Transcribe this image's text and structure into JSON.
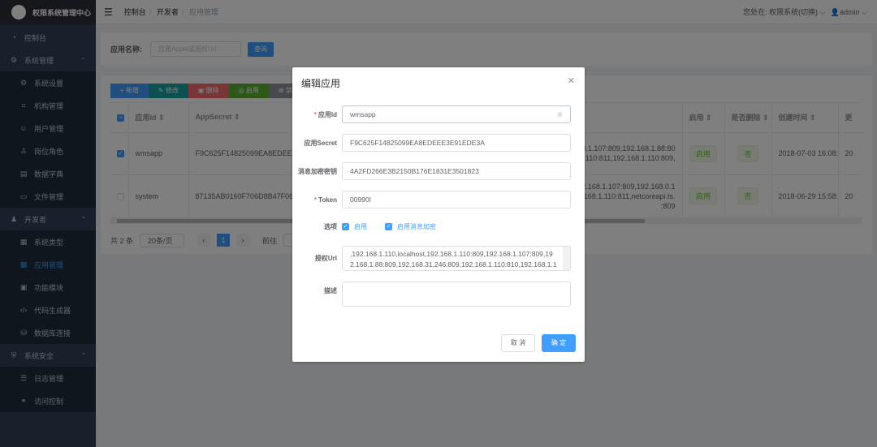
{
  "app": {
    "title": "权限系统管理中心"
  },
  "sidebar": {
    "items": [
      {
        "label": "控制台",
        "icon": "dashboard-icon",
        "type": "top"
      },
      {
        "label": "系统管理",
        "icon": "gear-icon",
        "type": "group"
      },
      {
        "label": "系统设置",
        "icon": "gear-icon",
        "type": "sub"
      },
      {
        "label": "机构管理",
        "icon": "org-icon",
        "type": "sub"
      },
      {
        "label": "用户管理",
        "icon": "user-icon",
        "type": "sub"
      },
      {
        "label": "岗位角色",
        "icon": "role-icon",
        "type": "sub"
      },
      {
        "label": "数据字典",
        "icon": "dictionary-icon",
        "type": "sub"
      },
      {
        "label": "文件管理",
        "icon": "file-icon",
        "type": "sub"
      },
      {
        "label": "开发者",
        "icon": "developer-icon",
        "type": "group"
      },
      {
        "label": "系统类型",
        "icon": "calendar-icon",
        "type": "sub"
      },
      {
        "label": "应用管理",
        "icon": "grid-icon",
        "type": "sub",
        "active": true
      },
      {
        "label": "功能模块",
        "icon": "module-icon",
        "type": "sub"
      },
      {
        "label": "代码生成器",
        "icon": "code-icon",
        "type": "sub"
      },
      {
        "label": "数据库连接",
        "icon": "database-icon",
        "type": "sub"
      },
      {
        "label": "系统安全",
        "icon": "shield-icon",
        "type": "group"
      },
      {
        "label": "日志管理",
        "icon": "log-icon",
        "type": "sub"
      },
      {
        "label": "访问控制",
        "icon": "link-icon",
        "type": "sub"
      }
    ]
  },
  "header": {
    "breadcrumb": [
      "控制台",
      "开发者",
      "应用管理"
    ],
    "location_label": "您处在: 权限系统(切换)",
    "user": "admin"
  },
  "search": {
    "label": "应用名称:",
    "placeholder": "应用AppId或授权Url",
    "button": "查询"
  },
  "toolbar": [
    {
      "label": "+ 新增",
      "color": "#409eff"
    },
    {
      "label": "✎ 修改",
      "color": "#17a2a2"
    },
    {
      "label": "▣ 删除",
      "color": "#f56c6c"
    },
    {
      "label": "◎ 启用",
      "color": "#5ab032"
    },
    {
      "label": "⊗ 禁用",
      "color": "#909399"
    },
    {
      "label": "C",
      "color": "#409eff"
    }
  ],
  "table": {
    "columns": [
      "应用Id ⇕",
      "AppSecret ⇕",
      "",
      "启用 ⇕",
      "是否删除 ⇕",
      "创建时间 ⇕",
      "更"
    ],
    "rows": [
      {
        "checked": true,
        "id": "wmsapp",
        "secret": "F9C625F14825099EA8EDEEE3E91",
        "urls": [
          "168.1.107:809,192.168.1.88:80",
          "68.1.110:811,192.168.1.110:809,"
        ],
        "enabled": "启用",
        "deleted": "否",
        "created": "2018-07-03 16:08:16",
        "updated": "20"
      },
      {
        "checked": false,
        "id": "system",
        "secret": "87135AB0160F706D8B47F06BDAB",
        "urls": [
          "1,192.168.1.107:809,192.168.0.1",
          "192.168.1.110:811,netcoreapi.ts.",
          ":809"
        ],
        "enabled": "启用",
        "deleted": "否",
        "created": "2018-06-29 15:58:05",
        "updated": "20"
      }
    ]
  },
  "pagination": {
    "total": "共 2 条",
    "page_size": "20条/页",
    "current": "1",
    "goto_label": "前往",
    "goto_value": "1"
  },
  "dialog": {
    "title": "编辑应用",
    "fields": {
      "app_id": {
        "label": "应用Id",
        "value": "wmsapp",
        "required": true
      },
      "app_secret": {
        "label": "应用Secret",
        "value": "F9C625F14825099EA8EDEEE3E91EDE3A"
      },
      "encrypt_key": {
        "label": "消息加密密钥",
        "value": "4A2FD266E3B2150B176E1831E3501823"
      },
      "token": {
        "label": "Token",
        "value": "00990I",
        "required": true
      },
      "options": {
        "label": "选项",
        "items": [
          {
            "label": "启用",
            "checked": true
          },
          {
            "label": "启用消息加密",
            "checked": true
          }
        ]
      },
      "auth_url": {
        "label": "授权Url",
        "value": ",192.168.1.110,localhost,192.168.1.110:809,192.168.1.107:809,192.168.1.88:809,192.168.31.246:809,192.168.1.110:810,192.168.1.110:81"
      },
      "description": {
        "label": "描述",
        "value": ""
      }
    },
    "cancel": "取 消",
    "confirm": "确 定"
  },
  "colors": {
    "primary": "#409eff",
    "sidebar": "#304156"
  }
}
